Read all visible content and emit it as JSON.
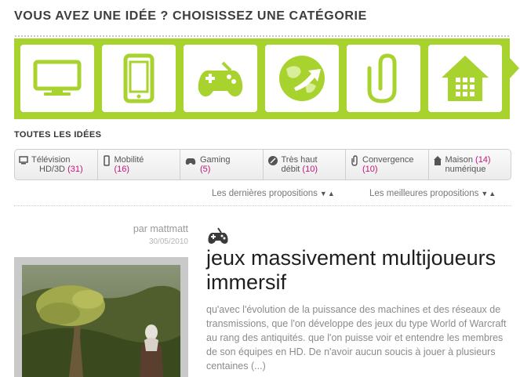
{
  "header": {
    "title": "VOUS AVEZ UNE IDÉE ? CHOISISSEZ UNE CATÉGORIE"
  },
  "categories_banner": {
    "accent_color": "#a8d22e",
    "tiles": [
      {
        "icon": "tv-icon"
      },
      {
        "icon": "smartphone-icon"
      },
      {
        "icon": "gamepad-icon"
      },
      {
        "icon": "globe-arrow-icon"
      },
      {
        "icon": "paperclip-icon"
      },
      {
        "icon": "house-icon"
      }
    ]
  },
  "all_ideas": {
    "label": "TOUTES LES IDÉES",
    "categories": [
      {
        "icon": "tv-icon",
        "name_line1": "Télévision",
        "name_line2": "HD/3D",
        "count": "(31)"
      },
      {
        "icon": "smartphone-icon",
        "name_line1": "Mobilité",
        "name_line2": "",
        "count": "(16)"
      },
      {
        "icon": "gamepad-icon",
        "name_line1": "Gaming",
        "name_line2": "",
        "count": "(5)"
      },
      {
        "icon": "globe-arrow-icon",
        "name_line1": "Très haut",
        "name_line2": "débit",
        "count": "(10)"
      },
      {
        "icon": "paperclip-icon",
        "name_line1": "Convergence",
        "name_line2": "",
        "count": "(10)"
      },
      {
        "icon": "house-icon",
        "name_line1": "Maison",
        "name_line2": "numérique",
        "count": "(14)"
      }
    ],
    "count_color": "#c0157b"
  },
  "sort": {
    "latest": "Les dernières propositions",
    "best": "Les meilleures propositions",
    "down_arrow": "▼",
    "up_arrow": "▲"
  },
  "idea": {
    "author": "par mattmatt",
    "date": "30/05/2010",
    "category_icon": "gamepad-icon",
    "title": "jeux massivement multijoueurs immersif",
    "excerpt": "qu'avec l'évolution de la puissance des machines et des réseaux de transmissions, que l'on développe des jeux du type World of Warcraft au rang des antiquités. que l'on puisse voir et entendre les membres de son équipes en HD. De n'avoir aucun soucis à jouer à plusieurs centaines (...)"
  }
}
